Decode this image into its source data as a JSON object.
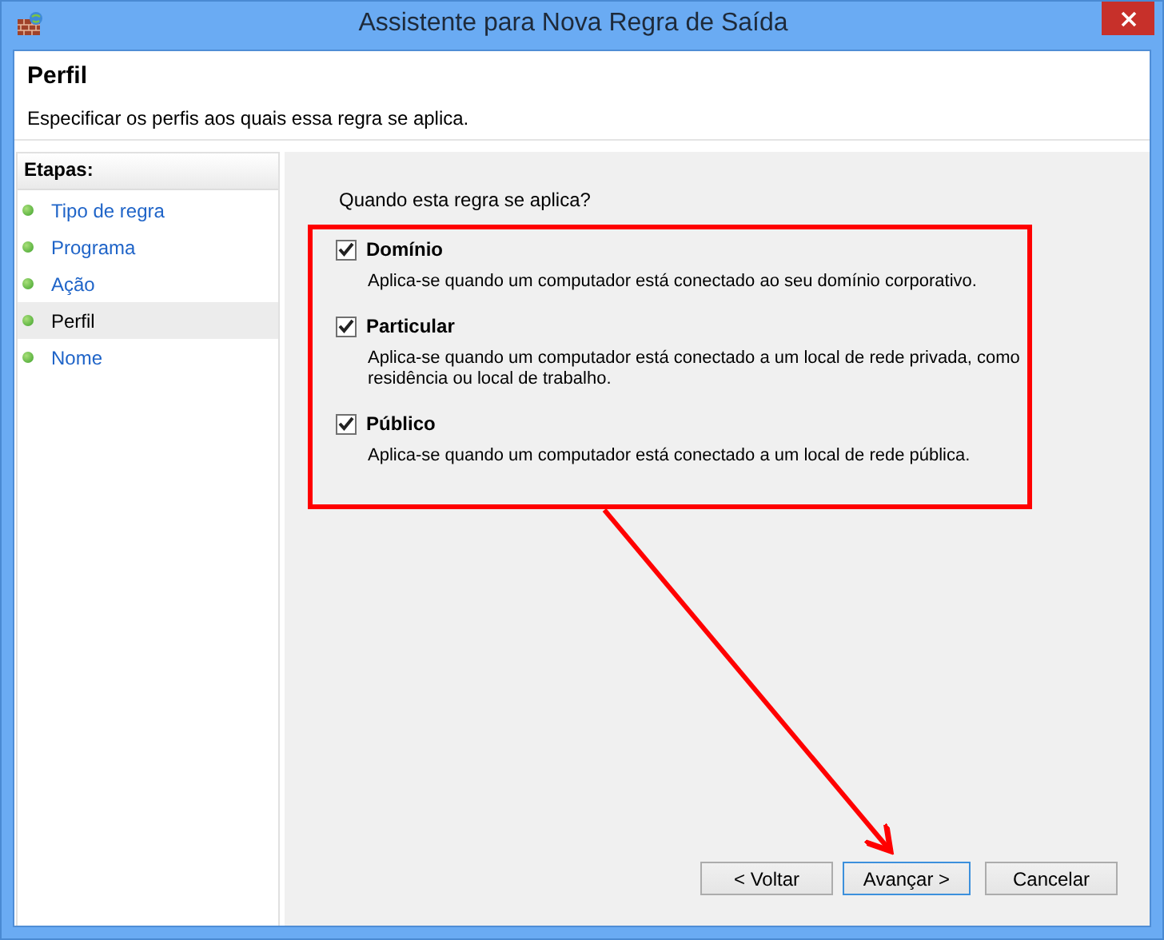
{
  "window": {
    "title": "Assistente para Nova Regra de Saída"
  },
  "header": {
    "title": "Perfil",
    "description": "Especificar os perfis aos quais essa regra se aplica."
  },
  "sidebar": {
    "heading": "Etapas:",
    "items": [
      {
        "label": "Tipo de regra",
        "selected": false
      },
      {
        "label": "Programa",
        "selected": false
      },
      {
        "label": "Ação",
        "selected": false
      },
      {
        "label": "Perfil",
        "selected": true
      },
      {
        "label": "Nome",
        "selected": false
      }
    ]
  },
  "main": {
    "question": "Quando esta regra se aplica?",
    "options": [
      {
        "label": "Domínio",
        "description": "Aplica-se quando um computador está conectado ao seu domínio corporativo.",
        "checked": true
      },
      {
        "label": "Particular",
        "description": "Aplica-se quando um computador está conectado a um local de rede privada, como residência ou local de trabalho.",
        "checked": true
      },
      {
        "label": "Público",
        "description": "Aplica-se quando um computador está conectado a um local de rede pública.",
        "checked": true
      }
    ]
  },
  "buttons": [
    {
      "label": "< Voltar",
      "focused": false
    },
    {
      "label": "Avançar >",
      "focused": true
    },
    {
      "label": "Cancelar",
      "focused": false
    }
  ]
}
